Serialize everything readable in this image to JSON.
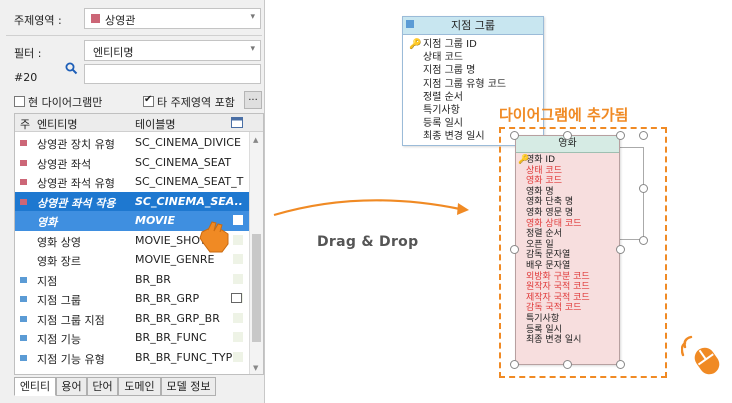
{
  "colors": {
    "accent_orange": "#f08a24",
    "selection_blue": "#1e78d0",
    "new_entity_fill": "#f7dede",
    "red_attr": "#e03a3a"
  },
  "panel": {
    "subject_label": "주제영역 :",
    "subject_value": "상영관",
    "filter_label": "필터 :",
    "filter_value": "엔티티명",
    "count_label": "#20",
    "search_icon": "search-icon",
    "current_diagram_only": "현 다이어그램만",
    "include_other_subjects": "타 주제영역 포함",
    "dots_button": "...",
    "grid": {
      "col_marker": "주",
      "col_entity": "엔티티명",
      "col_table": "테이블명",
      "rows": [
        {
          "entity": "상영관 장치 유형",
          "table": "SC_CINEMA_DIVICE",
          "bullet_color": "#cc6677"
        },
        {
          "entity": "상영관 좌석",
          "table": "SC_CINEMA_SEAT",
          "bullet_color": "#cc6677"
        },
        {
          "entity": "상영관 좌석 유형",
          "table": "SC_CINEMA_SEAT_T",
          "bullet_color": "#cc6677"
        },
        {
          "entity": "상영관 좌석 작용",
          "table": "SC_CINEMA_SEA..",
          "bullet_color": "#cc6677"
        },
        {
          "entity": "영화",
          "table": "MOVIE",
          "bullet_color": ""
        },
        {
          "entity": "영화 상영",
          "table": "MOVIE_SHOW",
          "bullet_color": ""
        },
        {
          "entity": "영화 장르",
          "table": "MOVIE_GENRE",
          "bullet_color": ""
        },
        {
          "entity": "지점",
          "table": "BR_BR",
          "bullet_color": "#5b9bd5"
        },
        {
          "entity": "지점 그룹",
          "table": "BR_BR_GRP",
          "bullet_color": "#5b9bd5"
        },
        {
          "entity": "지점 그룹 지점",
          "table": "BR_BR_GRP_BR",
          "bullet_color": "#5b9bd5"
        },
        {
          "entity": "지점 기능",
          "table": "BR_BR_FUNC",
          "bullet_color": "#5b9bd5"
        },
        {
          "entity": "지점 기능 유형",
          "table": "BR_BR_FUNC_TYPE",
          "bullet_color": "#5b9bd5"
        }
      ]
    },
    "tabs": [
      "엔티티",
      "용어",
      "단어",
      "도메인",
      "모델 정보"
    ]
  },
  "canvas": {
    "drag_text": "Drag & Drop",
    "added_label": "다이어그램에 추가됨",
    "branch_group": {
      "title": "지점 그룹",
      "attributes": [
        "지점 그룹 ID",
        "상태 코드",
        "지점 그룹 명",
        "지점 그룹 유형 코드",
        "정렬 순서",
        "특기사항",
        "등록 일시",
        "최종 변경 일시"
      ]
    },
    "movie": {
      "title": "영화",
      "attributes": [
        {
          "name": "영화 ID",
          "key": true,
          "red": false
        },
        {
          "name": "상태 코드",
          "key": false,
          "red": true
        },
        {
          "name": "영화 코드",
          "key": false,
          "red": true
        },
        {
          "name": "영화 명",
          "key": false,
          "red": false
        },
        {
          "name": "영화 단축 명",
          "key": false,
          "red": false
        },
        {
          "name": "영화 영문 명",
          "key": false,
          "red": false
        },
        {
          "name": "영화 상태 코드",
          "key": false,
          "red": true
        },
        {
          "name": "정렬 순서",
          "key": false,
          "red": false
        },
        {
          "name": "오픈 일",
          "key": false,
          "red": false
        },
        {
          "name": "감독 문자열",
          "key": false,
          "red": false
        },
        {
          "name": "배우 문자열",
          "key": false,
          "red": false
        },
        {
          "name": "외방화 구분 코드",
          "key": false,
          "red": true
        },
        {
          "name": "원작자 국적 코드",
          "key": false,
          "red": true
        },
        {
          "name": "제작자 국적 코드",
          "key": false,
          "red": true
        },
        {
          "name": "감독 국적 코드",
          "key": false,
          "red": true
        },
        {
          "name": "특기사항",
          "key": false,
          "red": false
        },
        {
          "name": "등록 일시",
          "key": false,
          "red": false
        },
        {
          "name": "최종 변경 일시",
          "key": false,
          "red": false
        }
      ]
    }
  }
}
